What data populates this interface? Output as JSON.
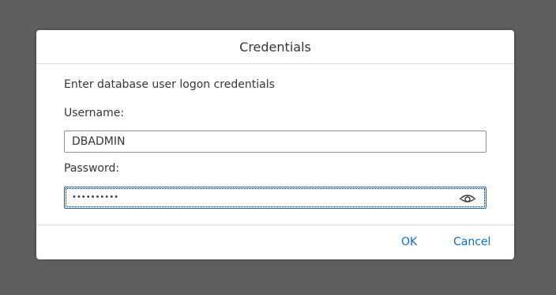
{
  "dialog": {
    "title": "Credentials",
    "instruction": "Enter database user logon credentials",
    "username": {
      "label": "Username:",
      "value": "DBADMIN"
    },
    "password": {
      "label": "Password:",
      "masked_value": "••••••••••",
      "toggle_icon": "eye-icon"
    },
    "buttons": {
      "ok": "OK",
      "cancel": "Cancel"
    }
  },
  "colors": {
    "backdrop": "#5f5f5f",
    "accent": "#0a6ed1",
    "text": "#32363a"
  }
}
